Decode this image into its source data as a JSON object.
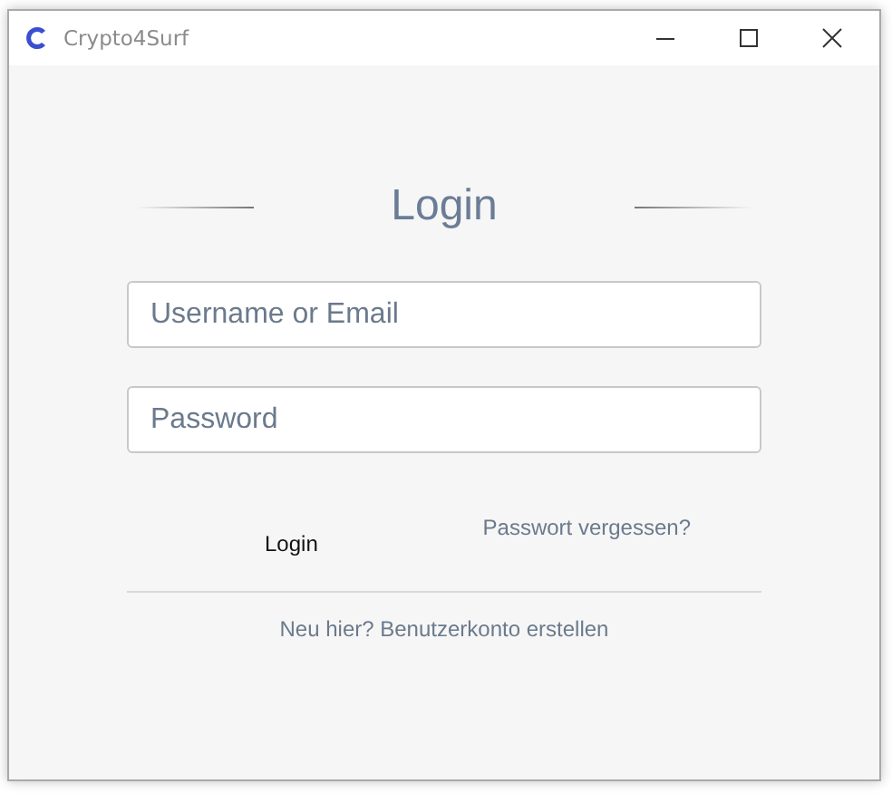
{
  "window": {
    "title": "Crypto4Surf"
  },
  "heading": "Login",
  "fields": [
    {
      "placeholder": "Username or Email"
    },
    {
      "placeholder": "Password"
    }
  ],
  "login_button": "Login",
  "forgot_link": "Passwort vergessen?",
  "register_link": "Neu hier? Benutzerkonto erstellen"
}
